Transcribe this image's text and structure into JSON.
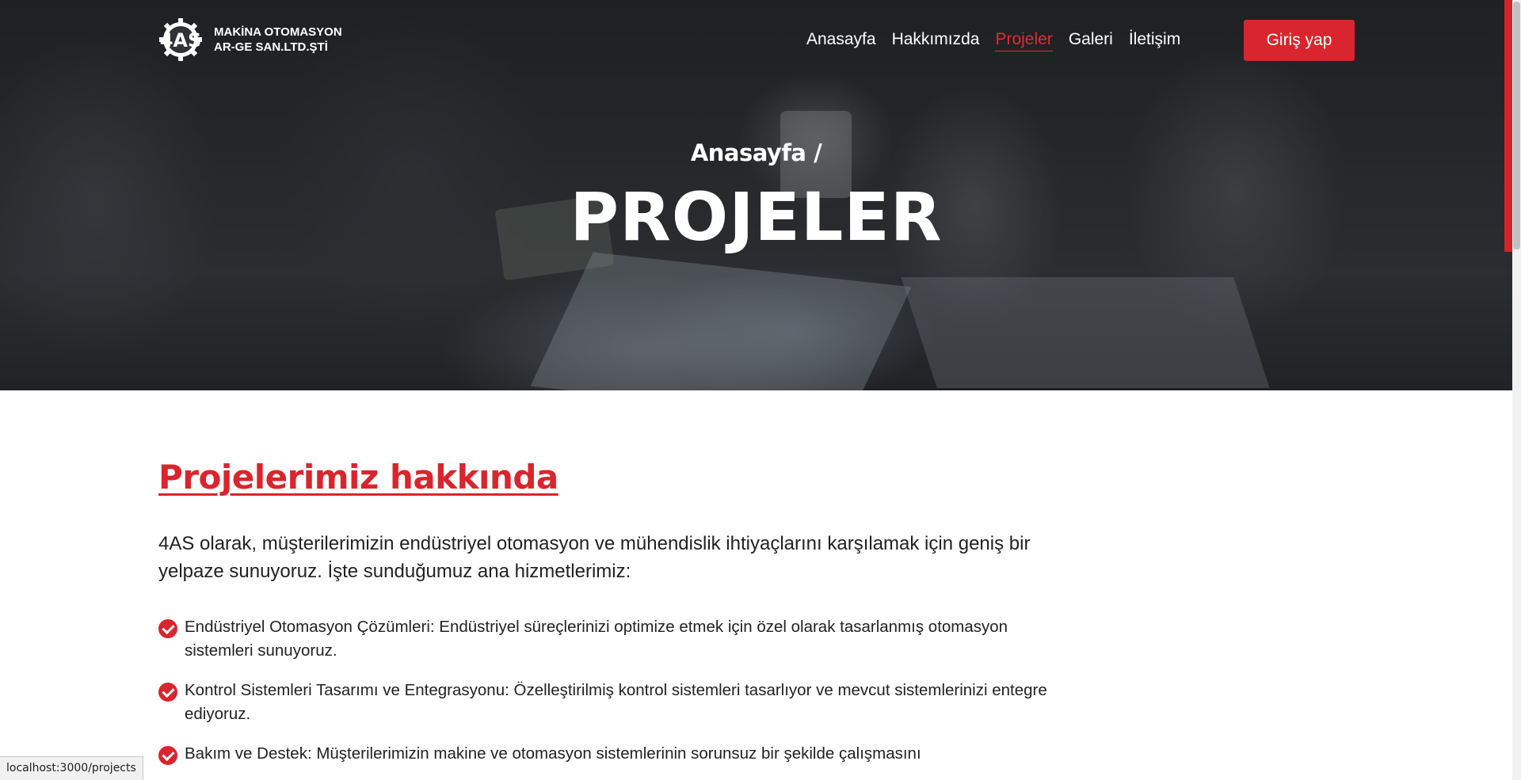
{
  "header": {
    "logo_line1": "MAKİNA OTOMASYON",
    "logo_line2": "AR-GE SAN.LTD.ŞTİ",
    "logo_mark_text": "4AS",
    "nav": [
      {
        "label": "Anasayfa",
        "active": false
      },
      {
        "label": "Hakkımızda",
        "active": false
      },
      {
        "label": "Projeler",
        "active": true
      },
      {
        "label": "Galeri",
        "active": false
      },
      {
        "label": "İletişim",
        "active": false
      }
    ],
    "login_label": "Giriş yap"
  },
  "hero": {
    "breadcrumb": "Anasayfa /",
    "title": "PROJELER"
  },
  "main": {
    "section_title": "Projelerimiz hakkında",
    "intro": "4AS olarak, müşterilerimizin endüstriyel otomasyon ve mühendislik ihtiyaçlarını karşılamak için geniş bir yelpaze sunuyoruz. İşte sunduğumuz ana hizmetlerimiz:",
    "services": [
      "Endüstriyel Otomasyon Çözümleri: Endüstriyel süreçlerinizi optimize etmek için özel olarak tasarlanmış otomasyon sistemleri sunuyoruz.",
      "Kontrol Sistemleri Tasarımı ve Entegrasyonu: Özelleştirilmiş kontrol sistemleri tasarlıyor ve mevcut sistemlerinizi entegre ediyoruz.",
      "Bakım ve Destek: Müşterilerimizin makine ve otomasyon sistemlerinin sorunsuz bir şekilde çalışmasını"
    ]
  },
  "status_bar": {
    "url": "localhost:3000/projects"
  },
  "colors": {
    "accent": "#d9252d",
    "hero_overlay": "#2b2d30"
  },
  "icons": {
    "logo": "gear-4as-logo-icon",
    "list_bullet": "check-circle-icon"
  }
}
